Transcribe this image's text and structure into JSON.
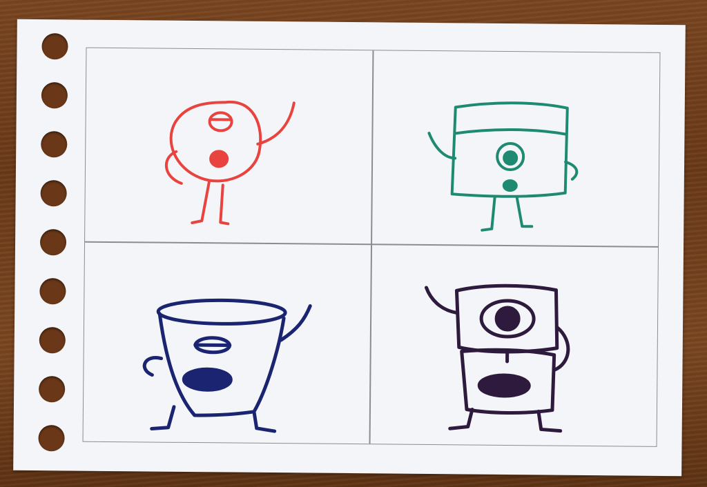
{
  "scene": {
    "subject": "hand-drawn-monster-sketches",
    "background_color": "#6b3a18",
    "paper_color": "#f3f5f8",
    "grid_line_color": "#8c8c8c"
  },
  "monsters": [
    {
      "ink_color": "#e8433f",
      "shape": "round-body-waving"
    },
    {
      "ink_color": "#1f8a72",
      "shape": "box-body-one-eye"
    },
    {
      "ink_color": "#1a2470",
      "shape": "cup-body-waving"
    },
    {
      "ink_color": "#2e1a3c",
      "shape": "stacked-box-big-eye"
    }
  ]
}
